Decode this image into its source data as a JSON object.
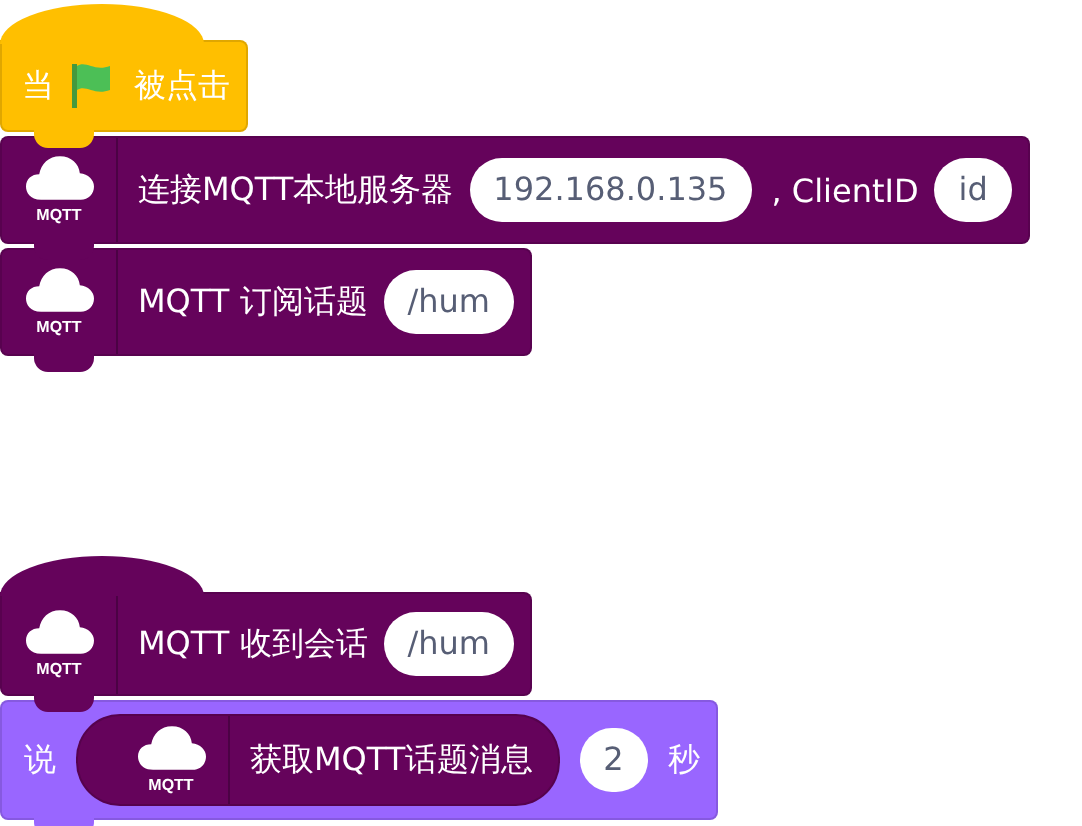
{
  "scripts": [
    {
      "blocks": [
        {
          "kind": "event_hat",
          "parts": [
            {
              "kind": "text",
              "text": "当"
            },
            {
              "kind": "flag"
            },
            {
              "kind": "text",
              "text": "被点击"
            }
          ]
        },
        {
          "kind": "mqtt_command",
          "icon_label": "MQTT",
          "parts": [
            {
              "kind": "text",
              "text": "连接MQTT本地服务器"
            },
            {
              "kind": "field",
              "text": "192.168.0.135"
            },
            {
              "kind": "text",
              "text": ", ClientID"
            },
            {
              "kind": "field",
              "text": "id"
            }
          ]
        },
        {
          "kind": "mqtt_command",
          "icon_label": "MQTT",
          "parts": [
            {
              "kind": "text",
              "text": "MQTT 订阅话题"
            },
            {
              "kind": "field",
              "text": "/hum"
            }
          ]
        }
      ]
    },
    {
      "blocks": [
        {
          "kind": "mqtt_hat",
          "icon_label": "MQTT",
          "parts": [
            {
              "kind": "text",
              "text": "MQTT 收到会话"
            },
            {
              "kind": "field",
              "text": "/hum"
            }
          ]
        },
        {
          "kind": "looks_command",
          "parts": [
            {
              "kind": "text",
              "text": "说"
            },
            {
              "kind": "mqtt_reporter",
              "icon_label": "MQTT",
              "text": "获取MQTT话题消息"
            },
            {
              "kind": "field",
              "text": "2"
            },
            {
              "kind": "text",
              "text": "秒"
            }
          ]
        }
      ]
    }
  ]
}
